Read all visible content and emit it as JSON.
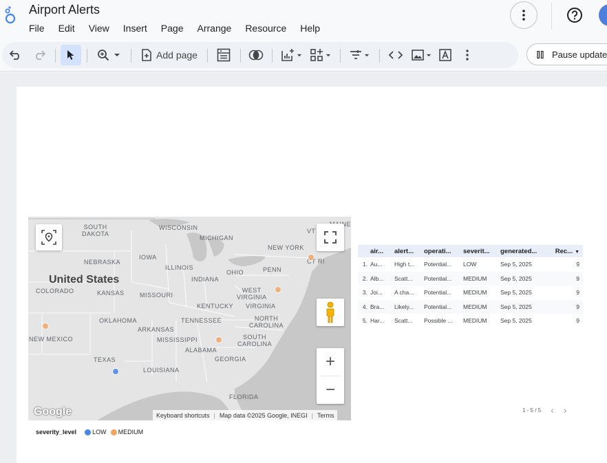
{
  "app": {
    "title": "Airport Alerts",
    "menu": [
      "File",
      "Edit",
      "View",
      "Insert",
      "Page",
      "Arrange",
      "Resource",
      "Help"
    ]
  },
  "toolbar": {
    "add_page_label": "Add page",
    "pause_label": "Pause updates",
    "icons": [
      "undo-icon",
      "redo-icon",
      "select-icon",
      "zoom-icon",
      "add-page-icon",
      "report-settings-icon",
      "theme-icon",
      "add-chart-icon",
      "add-control-icon",
      "filter-icon",
      "embed-icon",
      "image-icon",
      "text-icon",
      "more-icon"
    ]
  },
  "map": {
    "country_label": "United States",
    "labels": [
      "SOUTH DAKOTA",
      "WISCONSIN",
      "MICHIGAN",
      "VT",
      "MAINE",
      "NEW YORK",
      "IOWA",
      "NEBRASKA",
      "ILLINOIS",
      "PENN",
      "CT",
      "RI",
      "INDIANA",
      "OHIO",
      "COLORADO",
      "KANSAS",
      "MISSOURI",
      "WEST VIRGINIA",
      "KENTUCKY",
      "VIRGINIA",
      "OKLAHOMA",
      "TENNESSEE",
      "NORTH CAROLINA",
      "ARKANSAS",
      "NEW MEXICO",
      "MISSISSIPPI",
      "SOUTH CAROLINA",
      "ALABAMA",
      "GEORGIA",
      "TEXAS",
      "LOUISIANA",
      "FLORIDA"
    ],
    "attribution": {
      "shortcuts": "Keyboard shortcuts",
      "data": "Map data ©2025 Google, INEGI",
      "terms": "Terms"
    },
    "logo": "Google",
    "zoom_in": "+",
    "zoom_out": "−",
    "markers": [
      {
        "severity": "MEDIUM"
      },
      {
        "severity": "MEDIUM"
      },
      {
        "severity": "MEDIUM"
      },
      {
        "severity": "MEDIUM"
      },
      {
        "severity": "LOW"
      }
    ]
  },
  "legend": {
    "title": "severity_level",
    "items": [
      {
        "label": "LOW",
        "color": "#4a86e8"
      },
      {
        "label": "MEDIUM",
        "color": "#f4a460"
      }
    ]
  },
  "table": {
    "headers": [
      "air...",
      "alert...",
      "operati...",
      "severit...",
      "generated...",
      "Rec..."
    ],
    "rows": [
      {
        "n": "1.",
        "c1": "Au...",
        "c2": "High t...",
        "c3": "Potential...",
        "c4": "LOW",
        "c5": "Sep 5, 2025",
        "c6": "9"
      },
      {
        "n": "2.",
        "c1": "Alb...",
        "c2": "Scatt...",
        "c3": "Potential...",
        "c4": "MEDIUM",
        "c5": "Sep 5, 2025",
        "c6": "9"
      },
      {
        "n": "3.",
        "c1": "Joi...",
        "c2": "A cha...",
        "c3": "Potential...",
        "c4": "MEDIUM",
        "c5": "Sep 5, 2025",
        "c6": "9"
      },
      {
        "n": "4.",
        "c1": "Bra...",
        "c2": "Likely...",
        "c3": "Potential...",
        "c4": "MEDIUM",
        "c5": "Sep 5, 2025",
        "c6": "9"
      },
      {
        "n": "5.",
        "c1": "Har...",
        "c2": "Scatt...",
        "c3": "Possible ...",
        "c4": "MEDIUM",
        "c5": "Sep 5, 2025",
        "c6": "9"
      }
    ],
    "pagination": "1 - 5 / 5"
  },
  "colors": {
    "low": "#4a86e8",
    "medium": "#f4a460",
    "accent": "#1a73e8"
  }
}
